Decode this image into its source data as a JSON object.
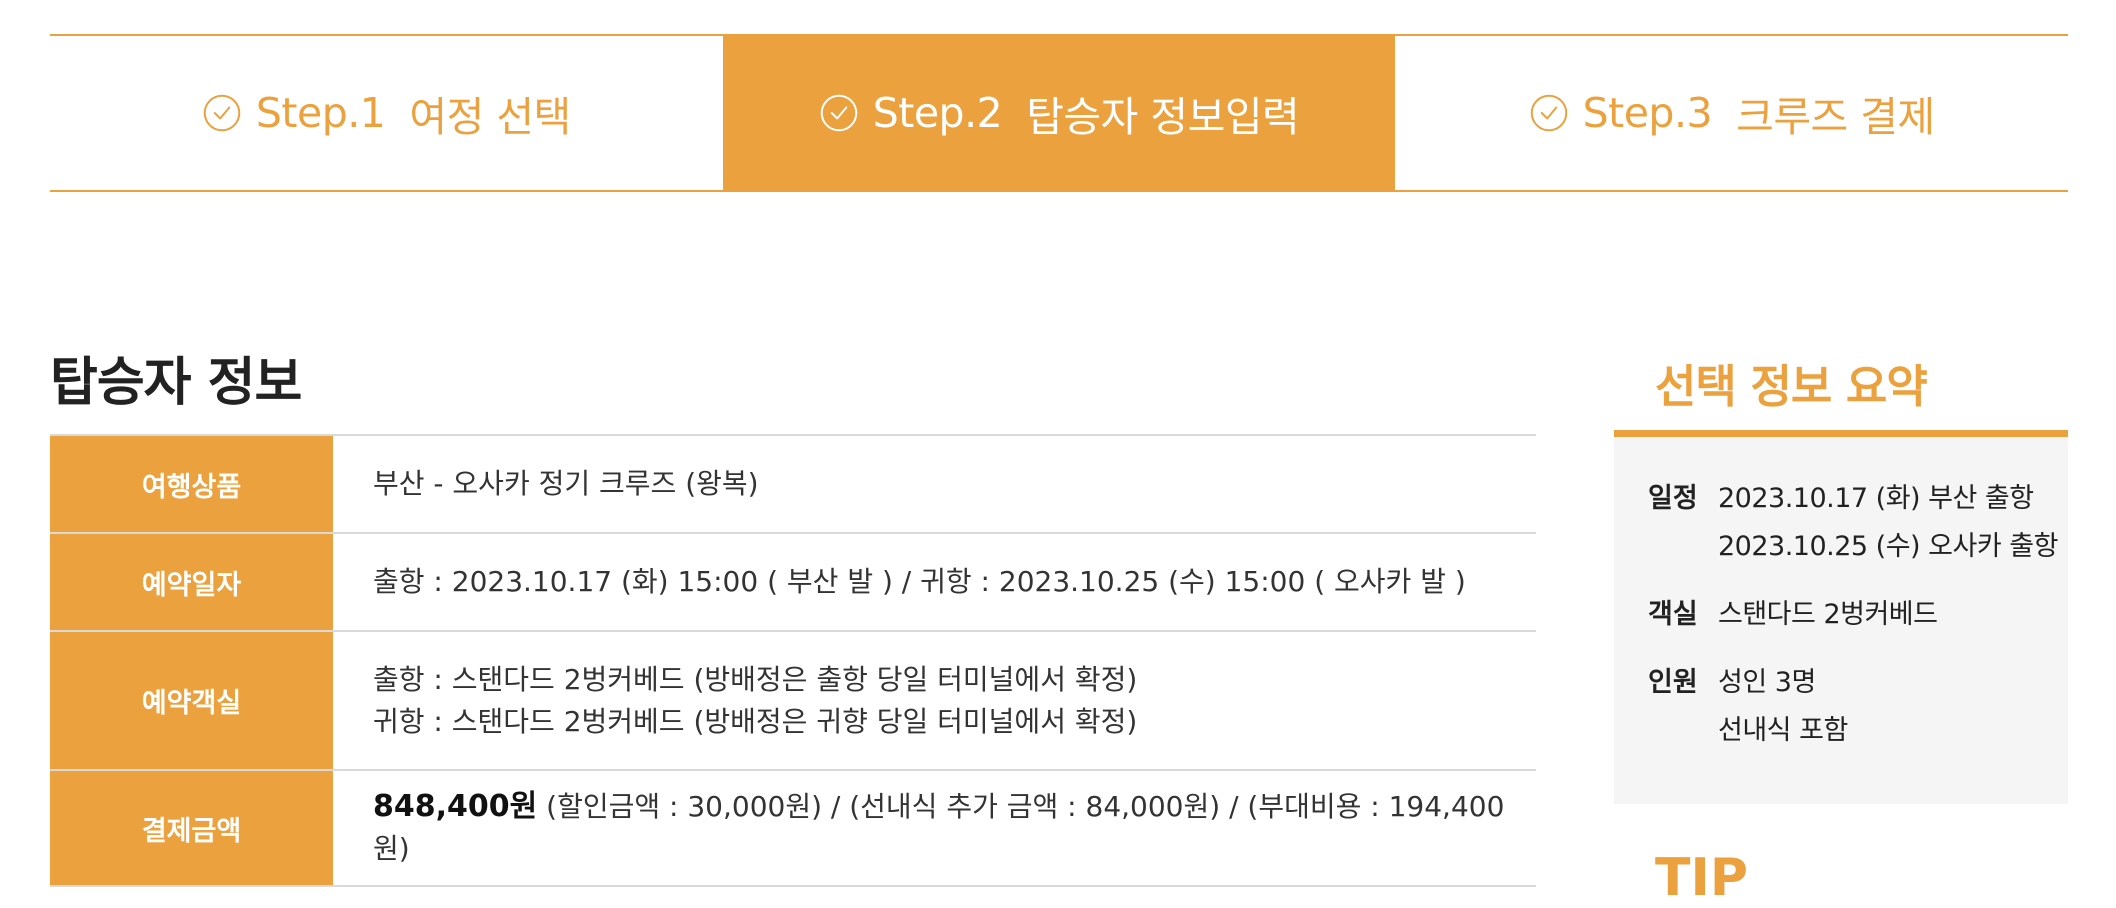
{
  "steps": [
    {
      "num": "Step.1",
      "label": "여정 선택",
      "active": false
    },
    {
      "num": "Step.2",
      "label": "탑승자 정보입력",
      "active": true
    },
    {
      "num": "Step.3",
      "label": "크루즈 결제",
      "active": false
    }
  ],
  "section_title": "탑승자 정보",
  "table": {
    "product": {
      "label": "여행상품",
      "value": "부산 - 오사카 정기 크루즈 (왕복)"
    },
    "date": {
      "label": "예약일자",
      "value": "출항 : 2023.10.17 (화) 15:00 ( 부산 발 ) / 귀항 : 2023.10.25 (수) 15:00 ( 오사카 발 )"
    },
    "cabin": {
      "label": "예약객실",
      "line1": "출항 : 스탠다드 2벙커베드 (방배정은 출항 당일 터미널에서 확정)",
      "line2": "귀항 : 스탠다드 2벙커베드 (방배정은 귀향 당일 터미널에서 확정)"
    },
    "payment": {
      "label": "결제금액",
      "amount": "848,400원",
      "detail": " (할인금액 : 30,000원) / (선내식 추가 금액 : 84,000원) / (부대비용 : 194,400원)"
    }
  },
  "summary": {
    "title": "선택 정보 요약",
    "schedule": {
      "label": "일정",
      "line1": "2023.10.17 (화) 부산 출항",
      "line2": "2023.10.25 (수) 오사카 출항"
    },
    "room": {
      "label": "객실",
      "value": "스탠다드 2벙커베드"
    },
    "people": {
      "label": "인원",
      "line1": "성인 3명",
      "line2": "선내식 포함"
    }
  },
  "tip_title": "TIP",
  "colors": {
    "accent": "#eba13e"
  },
  "icons": {
    "step_check": "check-circle-icon"
  }
}
